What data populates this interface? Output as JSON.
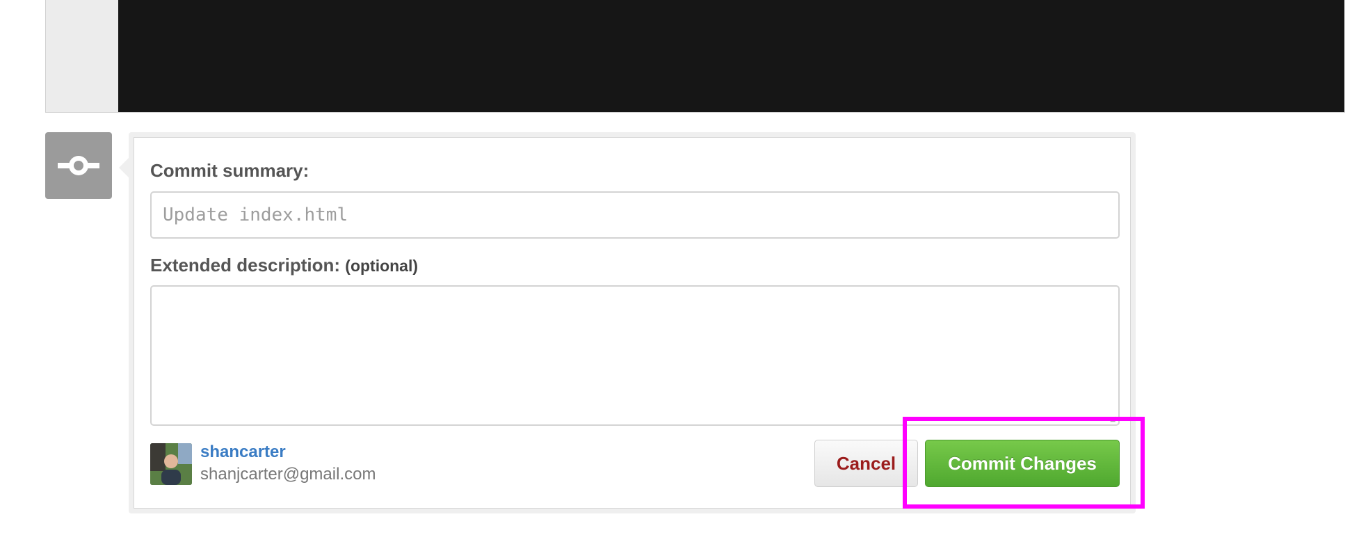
{
  "form": {
    "summary_label": "Commit summary:",
    "summary_placeholder": "Update index.html",
    "description_label": "Extended description:",
    "description_optional": "(optional)",
    "description_value": ""
  },
  "author": {
    "username": "shancarter",
    "email": "shanjcarter@gmail.com"
  },
  "actions": {
    "cancel_label": "Cancel",
    "commit_label": "Commit Changes"
  },
  "icons": {
    "commit": "commit-icon"
  },
  "colors": {
    "commit_button": "#5cb83a",
    "cancel_text": "#9b1c1c",
    "username": "#3a7cc4",
    "highlight": "#ff00ff"
  }
}
